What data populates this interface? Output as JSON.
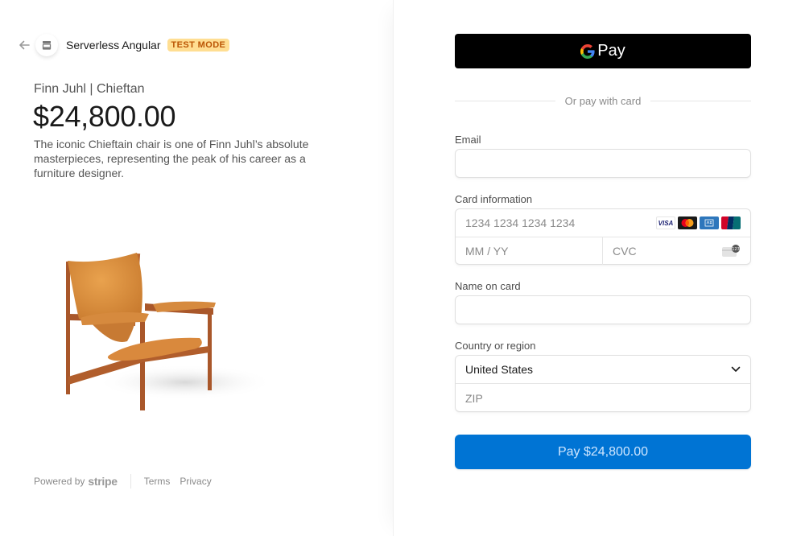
{
  "merchant": {
    "name": "Serverless Angular",
    "mode_badge": "TEST MODE",
    "icons": {
      "back": "arrow-left-icon",
      "merchant": "store-icon"
    }
  },
  "product": {
    "name": "Finn Juhl | Chieftan",
    "price": "$24,800.00",
    "description": "The iconic Chieftain chair is one of Finn Juhl’s absolute masterpieces, representing the peak of his career as a furniture designer.",
    "image_alt": "Chieftain chair"
  },
  "footer": {
    "powered_by": "Powered by",
    "brand": "stripe",
    "links": [
      "Terms",
      "Privacy"
    ]
  },
  "payment": {
    "gpay_label": "Pay",
    "divider_text": "Or pay with card",
    "email": {
      "label": "Email",
      "value": "",
      "placeholder": ""
    },
    "card": {
      "label": "Card information",
      "number_placeholder": "1234 1234 1234 1234",
      "expiry_placeholder": "MM / YY",
      "cvc_placeholder": "CVC",
      "brands": [
        "VISA",
        "Mastercard",
        "American Express",
        "UnionPay"
      ]
    },
    "name": {
      "label": "Name on card",
      "value": "",
      "placeholder": ""
    },
    "country": {
      "label": "Country or region",
      "selected": "United States",
      "zip_placeholder": "ZIP"
    },
    "pay_button": "Pay $24,800.00"
  },
  "colors": {
    "accent": "#0074d4",
    "badge_bg": "#ffde92",
    "badge_text": "#bb5504",
    "gpay_bg": "#000000"
  }
}
